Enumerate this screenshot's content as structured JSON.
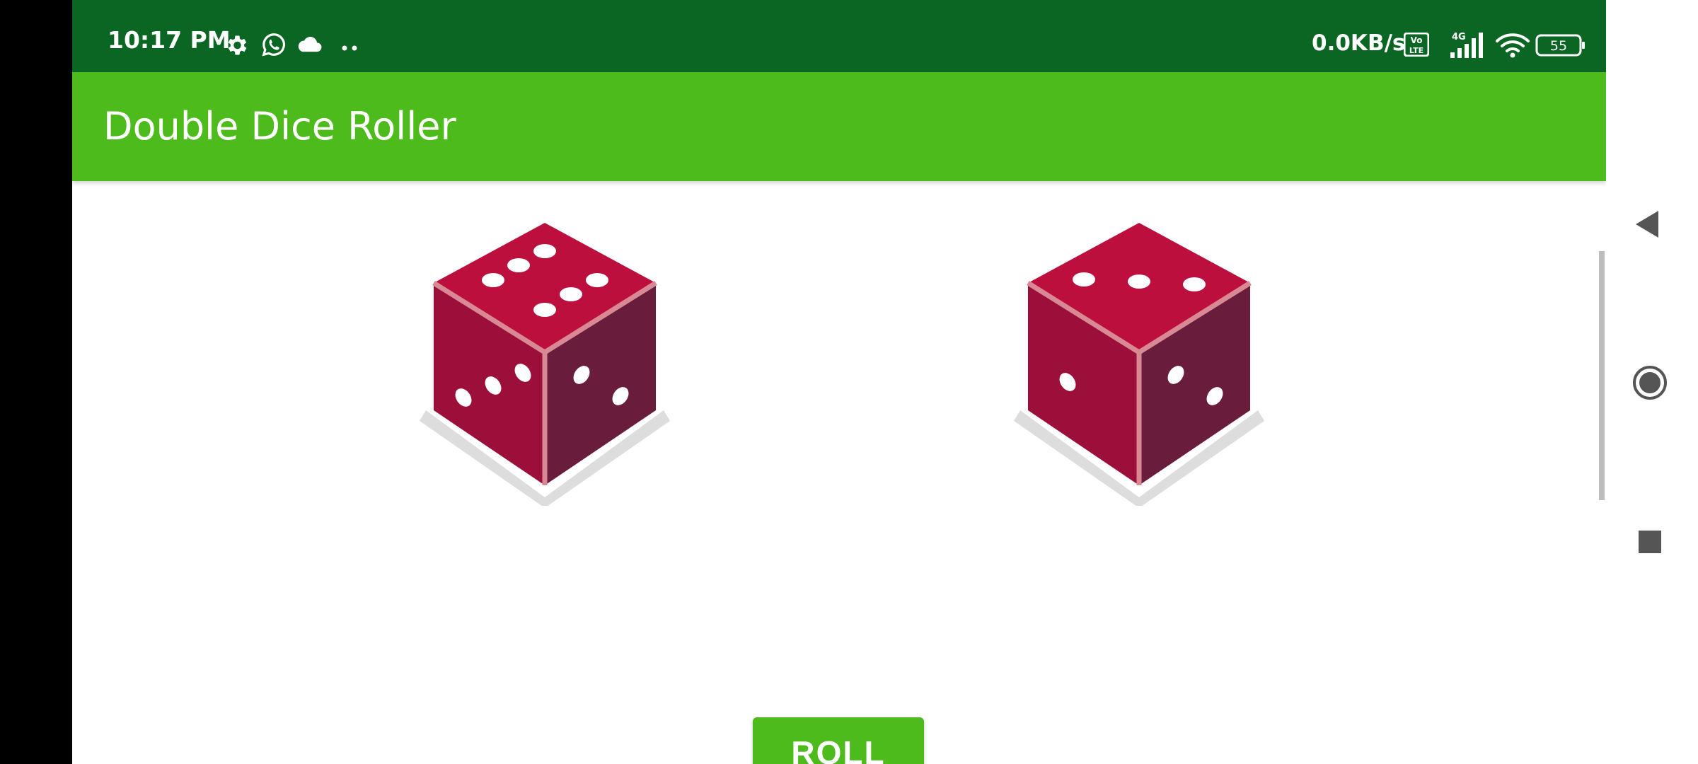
{
  "status_bar": {
    "time": "10:17 PM",
    "network_speed": "0.0KB/s",
    "volte_badge": "Vo LTE",
    "signal_type": "4G",
    "battery_level": "55",
    "icons": [
      "gear-icon",
      "whatsapp-icon",
      "cloud-icon",
      "more-dots-icon",
      "volte-icon",
      "signal-icon",
      "wifi-icon",
      "battery-icon"
    ]
  },
  "app_bar": {
    "title": "Double Dice Roller",
    "color": "#4cbb1b"
  },
  "dice": {
    "left": {
      "top_face": 6,
      "left_face": 3,
      "right_face": 2
    },
    "right": {
      "top_face": 3,
      "left_face": 1,
      "right_face": 2
    },
    "colors": {
      "top": "#bd0f3e",
      "left": "#9c0f3b",
      "right": "#6a1c3c",
      "edge": "#d98994"
    }
  },
  "roll_button": {
    "label": "ROLL"
  },
  "nav_bar": {
    "icons": [
      "back-icon",
      "home-icon",
      "recents-icon"
    ]
  },
  "colors": {
    "status_bar": "#0b6623",
    "accent": "#4cbb1b"
  }
}
